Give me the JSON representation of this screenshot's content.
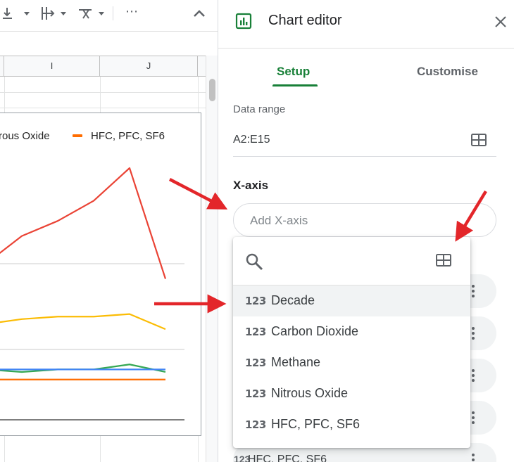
{
  "toolbar": {
    "items": [
      "download-align-icon",
      "vertical-align-icon",
      "text-rotate-icon"
    ],
    "more_label": "⋯"
  },
  "sheet": {
    "columns": [
      "I",
      "J"
    ]
  },
  "chart": {
    "legend": [
      "rous Oxide",
      "HFC, PFC, SF6"
    ],
    "series_colors": {
      "red": "#ea4335",
      "yellow": "#fbbc04",
      "blue": "#4285f4",
      "green": "#34a853",
      "orange": "#ff6d01"
    }
  },
  "chart_data": {
    "type": "line",
    "title": "",
    "legend_visible_entries": [
      "rous Oxide",
      "HFC, PFC, SF6"
    ],
    "series": [
      {
        "color": "#ea4335",
        "values": [
          0.62,
          0.73,
          0.79,
          0.87,
          1.0,
          0.56
        ]
      },
      {
        "color": "#fbbc04",
        "values": [
          0.38,
          0.4,
          0.41,
          0.41,
          0.42,
          0.36
        ]
      },
      {
        "color": "#4285f4",
        "values": [
          0.2,
          0.2,
          0.2,
          0.2,
          0.2,
          0.2
        ]
      },
      {
        "color": "#34a853",
        "values": [
          0.2,
          0.19,
          0.2,
          0.2,
          0.22,
          0.19
        ]
      },
      {
        "name": "HFC, PFC, SF6",
        "color": "#ff6d01",
        "values": [
          0.16,
          0.16,
          0.16,
          0.16,
          0.16,
          0.16
        ]
      }
    ]
  },
  "editor": {
    "title": "Chart editor",
    "tabs": [
      "Setup",
      "Customise"
    ],
    "active_tab": "Setup",
    "data_range_label": "Data range",
    "data_range_value": "A2:E15",
    "xaxis_label": "X-axis",
    "xaxis_placeholder": "Add X-axis",
    "peek_row_num": "123",
    "peek_row_text": "HFC, PFC, SF6"
  },
  "dropdown": {
    "search_placeholder": "",
    "items": [
      {
        "type_icon": "123",
        "label": "Decade",
        "active": true
      },
      {
        "type_icon": "123",
        "label": "Carbon Dioxide"
      },
      {
        "type_icon": "123",
        "label": "Methane"
      },
      {
        "type_icon": "123",
        "label": "Nitrous Oxide"
      },
      {
        "type_icon": "123",
        "label": "HFC, PFC, SF6"
      }
    ]
  },
  "colors": {
    "accent_green": "#188038",
    "arrow_red": "#e3262a"
  }
}
